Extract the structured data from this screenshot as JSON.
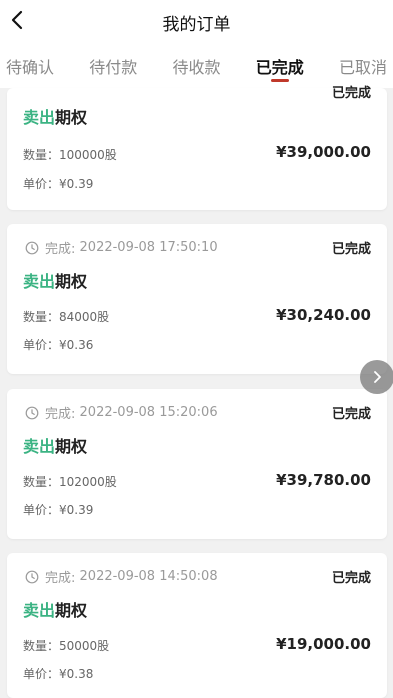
{
  "header": {
    "title": "我的订单",
    "back_icon": "chevron-left-icon"
  },
  "tabs": [
    {
      "label": "待确认",
      "active": false
    },
    {
      "label": "待付款",
      "active": false
    },
    {
      "label": "待收款",
      "active": false
    },
    {
      "label": "已完成",
      "active": true
    },
    {
      "label": "已取消",
      "active": false
    }
  ],
  "orders": [
    {
      "time_prefix": "",
      "time": "",
      "status": "已完成",
      "side": "卖出",
      "product": "期权",
      "quantity": "数量：100000股",
      "unit_price": "单价：¥0.39",
      "amount": "¥39,000.00"
    },
    {
      "time_prefix": "完成:",
      "time": "2022-09-08 17:50:10",
      "status": "已完成",
      "side": "卖出",
      "product": "期权",
      "quantity": "数量：84000股",
      "unit_price": "单价：¥0.36",
      "amount": "¥30,240.00"
    },
    {
      "time_prefix": "完成:",
      "time": "2022-09-08 15:20:06",
      "status": "已完成",
      "side": "卖出",
      "product": "期权",
      "quantity": "数量：102000股",
      "unit_price": "单价：¥0.39",
      "amount": "¥39,780.00"
    },
    {
      "time_prefix": "完成:",
      "time": "2022-09-08 14:50:08",
      "status": "已完成",
      "side": "卖出",
      "product": "期权",
      "quantity": "数量：50000股",
      "unit_price": "单价：¥0.38",
      "amount": "¥19,000.00"
    }
  ],
  "colors": {
    "accent_green": "#3bb383",
    "tab_underline": "#c0392b"
  },
  "icons": {
    "clock": "clock-icon",
    "scroll": "chevron-right-icon"
  }
}
